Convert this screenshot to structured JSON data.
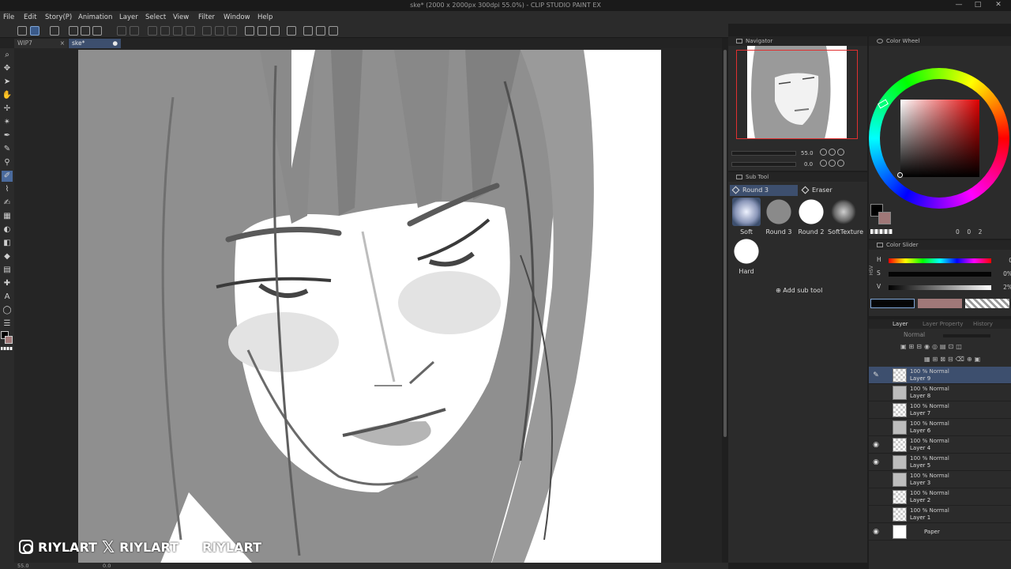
{
  "window": {
    "title": "ske* (2000 x 2000px 300dpi 55.0%)  - CLIP STUDIO PAINT EX",
    "controls": [
      "—",
      "□",
      "✕"
    ]
  },
  "menu": [
    "File",
    "Edit",
    "Story(P)",
    "Animation",
    "Layer",
    "Select",
    "View",
    "Filter",
    "Window",
    "Help"
  ],
  "tabs": [
    {
      "label": "WIP7",
      "close": "×"
    },
    {
      "label": "ske*",
      "close": "●"
    }
  ],
  "watermark": {
    "handle1": "RIYLART",
    "handle2": "RIYLART",
    "handle3": "RIYLART",
    "x_glyph": "𝕏"
  },
  "statusbar": {
    "zoom": "55.0",
    "angle": "0.0"
  },
  "navigator": {
    "title": "Navigator",
    "zoom": "55.0",
    "rotation": "0.0"
  },
  "subtool": {
    "title": "Sub Tool",
    "tabs": [
      "Round 3",
      "Eraser"
    ],
    "brushes": [
      {
        "label": "Soft",
        "type": "soft"
      },
      {
        "label": "Round 3",
        "type": "grey"
      },
      {
        "label": "Round 2",
        "type": "white"
      },
      {
        "label": "SoftTexture",
        "type": "texture"
      },
      {
        "label": "Hard",
        "type": "white"
      }
    ],
    "add_label": "Add sub tool"
  },
  "color_wheel": {
    "title": "Color Wheel",
    "main_color": "#000000",
    "sub_color": "#a07878",
    "readout": [
      "0",
      "0",
      "2"
    ]
  },
  "color_slider": {
    "title": "Color Slider",
    "mode_label": "HSV",
    "h_label": "H",
    "h_value": "0",
    "s_label": "S",
    "s_value": "0%",
    "v_label": "V",
    "v_value": "2%"
  },
  "layer_panel": {
    "tabs": [
      "Layer",
      "Layer Property",
      "History"
    ],
    "blend_mode": "Normal",
    "layers": [
      {
        "blend": "100 % Normal",
        "name": "Layer 9",
        "thumb": "checker",
        "visible": false,
        "selected": true
      },
      {
        "blend": "100 % Normal",
        "name": "Layer 8",
        "thumb": "face",
        "visible": false,
        "selected": false
      },
      {
        "blend": "100 % Normal",
        "name": "Layer 7",
        "thumb": "checker",
        "visible": false,
        "selected": false
      },
      {
        "blend": "100 % Normal",
        "name": "Layer 6",
        "thumb": "face",
        "visible": false,
        "selected": false
      },
      {
        "blend": "100 % Normal",
        "name": "Layer 4",
        "thumb": "checker",
        "visible": true,
        "selected": false
      },
      {
        "blend": "100 % Normal",
        "name": "Layer 5",
        "thumb": "face",
        "visible": true,
        "selected": false
      },
      {
        "blend": "100 % Normal",
        "name": "Layer 3",
        "thumb": "face",
        "visible": false,
        "selected": false
      },
      {
        "blend": "100 % Normal",
        "name": "Layer 2",
        "thumb": "checker",
        "visible": false,
        "selected": false
      },
      {
        "blend": "100 % Normal",
        "name": "Layer 1",
        "thumb": "checker",
        "visible": false,
        "selected": false
      },
      {
        "blend": "",
        "name": "Paper",
        "thumb": "plain",
        "visible": true,
        "selected": false
      }
    ]
  }
}
